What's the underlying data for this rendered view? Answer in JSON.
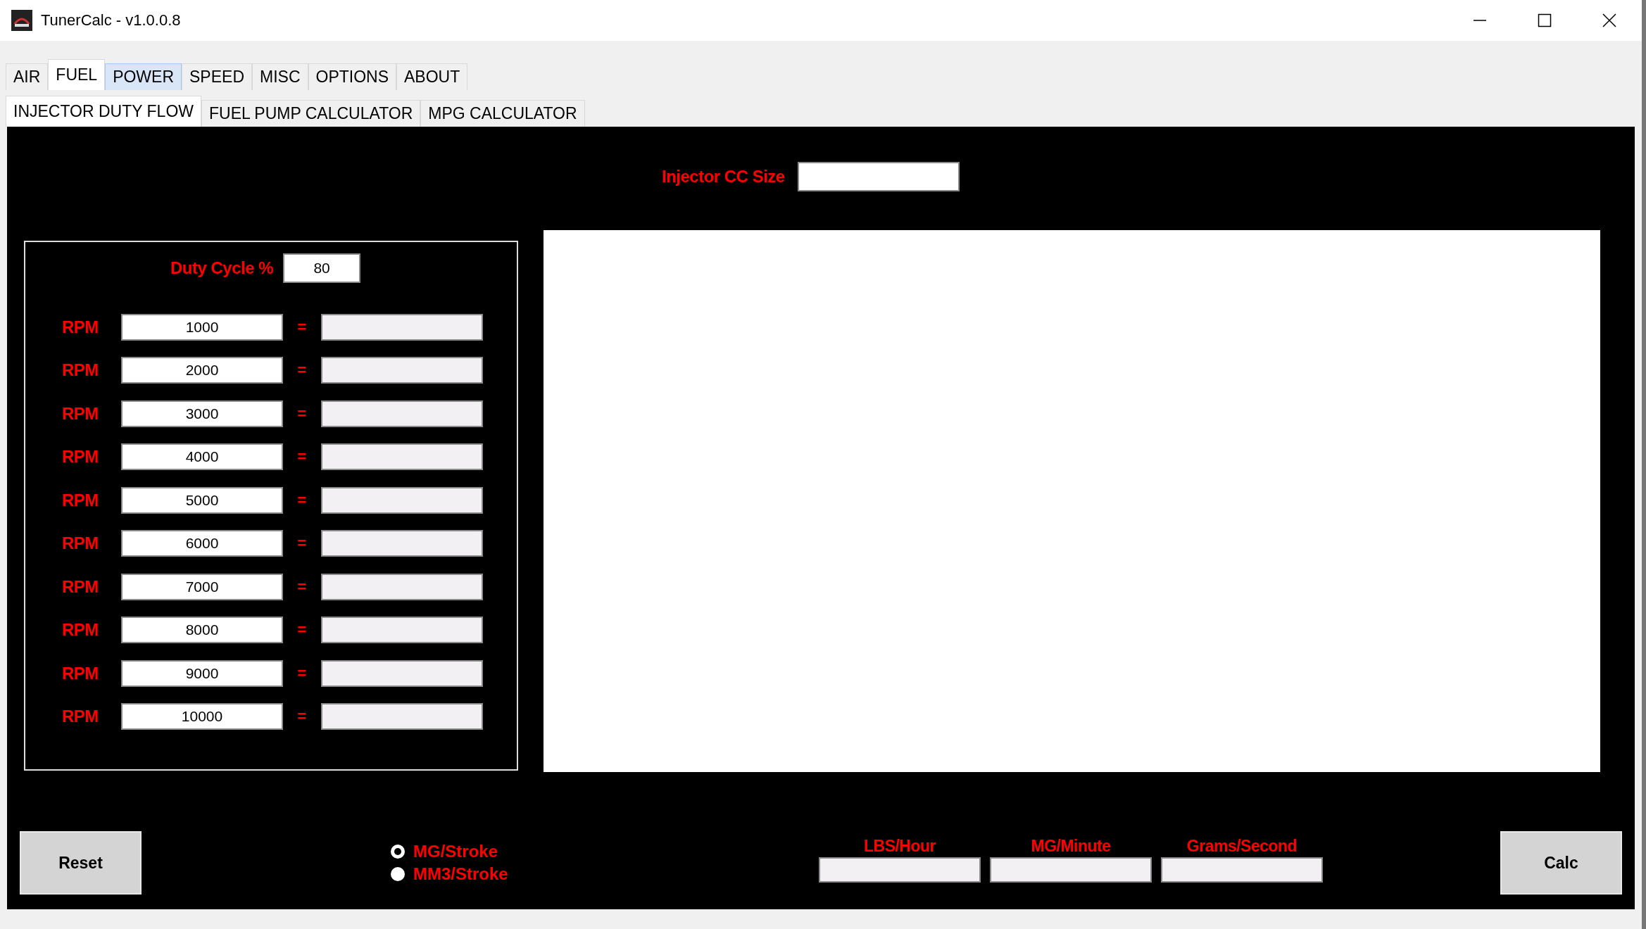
{
  "window": {
    "title": "TunerCalc - v1.0.0.8"
  },
  "tabs": [
    {
      "label": "AIR",
      "selected": false,
      "highlighted": false
    },
    {
      "label": "FUEL",
      "selected": true,
      "highlighted": false
    },
    {
      "label": "POWER",
      "selected": false,
      "highlighted": true
    },
    {
      "label": "SPEED",
      "selected": false,
      "highlighted": false
    },
    {
      "label": "MISC",
      "selected": false,
      "highlighted": false
    },
    {
      "label": "OPTIONS",
      "selected": false,
      "highlighted": false
    },
    {
      "label": "ABOUT",
      "selected": false,
      "highlighted": false
    }
  ],
  "subtabs": [
    {
      "label": "INJECTOR DUTY FLOW",
      "selected": true
    },
    {
      "label": "FUEL PUMP CALCULATOR",
      "selected": false
    },
    {
      "label": "MPG CALCULATOR",
      "selected": false
    }
  ],
  "injector_size": {
    "label": "Injector CC Size"
  },
  "duty_cycle": {
    "label": "Duty Cycle %",
    "value": "80"
  },
  "rpm_rows": [
    {
      "label": "RPM",
      "value": "1000",
      "equals": "="
    },
    {
      "label": "RPM",
      "value": "2000",
      "equals": "="
    },
    {
      "label": "RPM",
      "value": "3000",
      "equals": "="
    },
    {
      "label": "RPM",
      "value": "4000",
      "equals": "="
    },
    {
      "label": "RPM",
      "value": "5000",
      "equals": "="
    },
    {
      "label": "RPM",
      "value": "6000",
      "equals": "="
    },
    {
      "label": "RPM",
      "value": "7000",
      "equals": "="
    },
    {
      "label": "RPM",
      "value": "8000",
      "equals": "="
    },
    {
      "label": "RPM",
      "value": "9000",
      "equals": "="
    },
    {
      "label": "RPM",
      "value": "10000",
      "equals": "="
    }
  ],
  "reset_button": "Reset",
  "units": [
    {
      "label": "MG/Stroke",
      "selected": true
    },
    {
      "label": "MM3/Stroke",
      "selected": false
    }
  ],
  "outputs": [
    {
      "label": "LBS/Hour"
    },
    {
      "label": "MG/Minute"
    },
    {
      "label": "Grams/Second"
    }
  ],
  "calc_button": "Calc"
}
